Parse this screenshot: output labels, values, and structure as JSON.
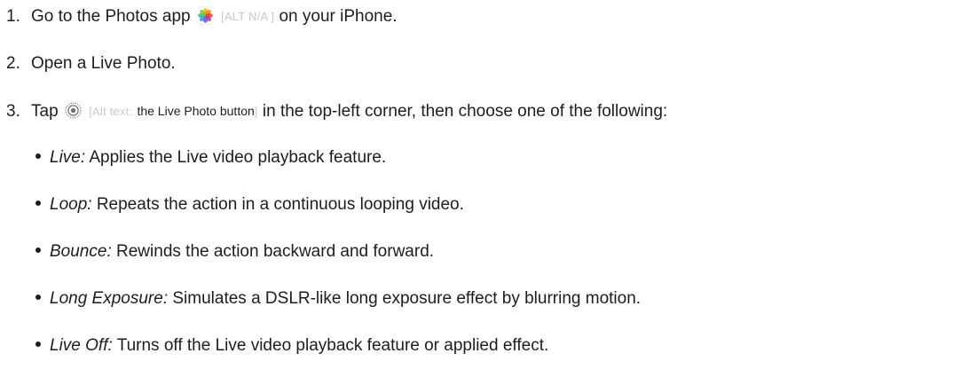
{
  "steps": [
    {
      "number": "1.",
      "text_before": "Go to the Photos app",
      "icon": "photos-app-icon",
      "alt_text": "[ALT N/A ]",
      "text_after": "on your iPhone."
    },
    {
      "number": "2.",
      "text": "Open a Live Photo."
    },
    {
      "number": "3.",
      "text_before": "Tap",
      "icon": "live-photo-icon",
      "alt_prefix": "[Alt text:",
      "alt_label": "the Live Photo button",
      "alt_suffix": "]",
      "text_after": "in the top-left corner, then choose one of the following:"
    }
  ],
  "options": [
    {
      "term": "Live:",
      "description": "Applies the Live video playback feature."
    },
    {
      "term": "Loop:",
      "description": "Repeats the action in a continuous looping video."
    },
    {
      "term": "Bounce:",
      "description": "Rewinds the action backward and forward."
    },
    {
      "term": "Long Exposure:",
      "description": "Simulates a DSLR-like long exposure effect by blurring motion."
    },
    {
      "term": "Live Off:",
      "description": "Turns off the Live video playback feature or applied effect."
    }
  ]
}
